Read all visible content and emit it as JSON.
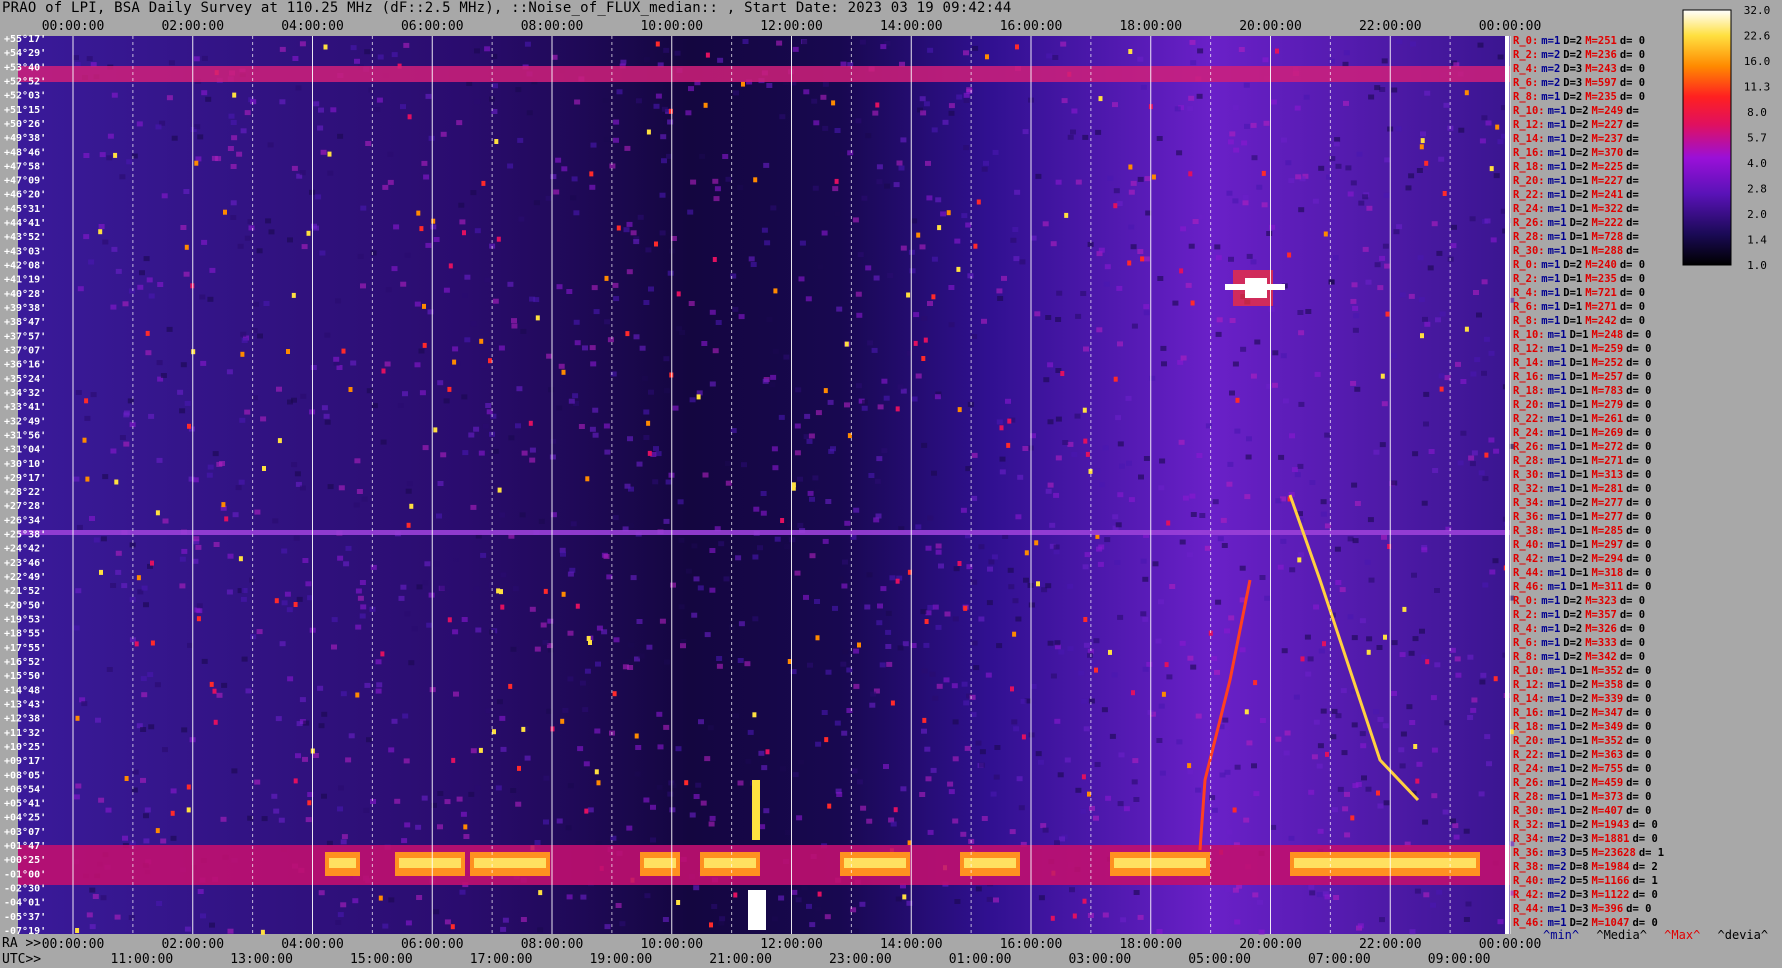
{
  "header": {
    "title": "PRAO of LPI, BSA Daily Survey at 110.25 MHz (dF::2.5 MHz), ::Noise_of_FLUX_median:: , Start Date: 2023 03 19 09:42:44"
  },
  "footer": {
    "ra_label": "RA >>",
    "utc_label": "UTC>>",
    "keys": [
      "^min^",
      "^Media^",
      "^Max^",
      "^devia^"
    ]
  },
  "chart_data": {
    "type": "heatmap",
    "title": "PRAO of LPI, BSA Daily Survey at 110.25 MHz (dF::2.5 MHz), ::Noise_of_FLUX_median:: , Start Date: 2023 03 19 09:42:44",
    "x_top_ticks": [
      "00:00:00",
      "02:00:00",
      "04:00:00",
      "06:00:00",
      "08:00:00",
      "10:00:00",
      "12:00:00",
      "14:00:00",
      "16:00:00",
      "18:00:00",
      "20:00:00",
      "22:00:00",
      "00:00:00"
    ],
    "x_bottom_ra_ticks": [
      "00:00:00",
      "02:00:00",
      "04:00:00",
      "06:00:00",
      "08:00:00",
      "10:00:00",
      "12:00:00",
      "14:00:00",
      "16:00:00",
      "18:00:00",
      "20:00:00",
      "22:00:00",
      "00:00:00"
    ],
    "x_bottom_utc_ticks": [
      "11:00:00",
      "13:00:00",
      "15:00:00",
      "17:00:00",
      "19:00:00",
      "21:00:00",
      "23:00:00",
      "01:00:00",
      "03:00:00",
      "05:00:00",
      "07:00:00",
      "09:00:00"
    ],
    "y_ticks": [
      "+55°17'",
      "+54°29'",
      "+53°40'",
      "+52°52'",
      "+52°03'",
      "+51°15'",
      "+50°26'",
      "+49°38'",
      "+48°46'",
      "+47°58'",
      "+47°09'",
      "+46°20'",
      "+45°31'",
      "+44°41'",
      "+43°52'",
      "+43°03'",
      "+42°08'",
      "+41°19'",
      "+40°28'",
      "+39°38'",
      "+38°47'",
      "+37°57'",
      "+37°07'",
      "+36°16'",
      "+35°24'",
      "+34°32'",
      "+33°41'",
      "+32°49'",
      "+31°56'",
      "+31°04'",
      "+30°10'",
      "+29°17'",
      "+28°22'",
      "+27°28'",
      "+26°34'",
      "+25°38'",
      "+24°42'",
      "+23°46'",
      "+22°49'",
      "+21°52'",
      "+20°50'",
      "+19°53'",
      "+18°55'",
      "+17°55'",
      "+16°52'",
      "+15°50'",
      "+14°48'",
      "+13°43'",
      "+12°38'",
      "+11°32'",
      "+10°25'",
      "+09°17'",
      "+08°05'",
      "+06°54'",
      "+05°41'",
      "+04°25'",
      "+03°07'",
      "+01°47'",
      "+00°25'",
      "-01°00'",
      "-02°30'",
      "-04°01'",
      "-05°37'",
      "-07°19'"
    ],
    "colorbar": {
      "ticks": [
        "32.0",
        "22.6",
        "16.0",
        "11.3",
        "8.0",
        "5.7",
        "4.0",
        "2.8",
        "2.0",
        "1.4",
        "1.0"
      ],
      "scale": "log"
    },
    "right_stats": [
      {
        "r": "R_0:",
        "m": "m=1",
        "D": "D=2",
        "M": "M=251",
        "d": "d= 0"
      },
      {
        "r": "R_2:",
        "m": "m=2",
        "D": "D=2",
        "M": "M=236",
        "d": "d= 0"
      },
      {
        "r": "R_4:",
        "m": "m=2",
        "D": "D=3",
        "M": "M=243",
        "d": "d= 0"
      },
      {
        "r": "R_6:",
        "m": "m=2",
        "D": "D=3",
        "M": "M=597",
        "d": "d= 0"
      },
      {
        "r": "R_8:",
        "m": "m=1",
        "D": "D=2",
        "M": "M=235",
        "d": "d= 0"
      },
      {
        "r": "R_10:",
        "m": "m=1",
        "D": "D=2",
        "M": "M=249",
        "d": "d="
      },
      {
        "r": "R_12:",
        "m": "m=1",
        "D": "D=2",
        "M": "M=227",
        "d": "d="
      },
      {
        "r": "R_14:",
        "m": "m=1",
        "D": "D=2",
        "M": "M=237",
        "d": "d="
      },
      {
        "r": "R_16:",
        "m": "m=1",
        "D": "D=2",
        "M": "M=370",
        "d": "d="
      },
      {
        "r": "R_18:",
        "m": "m=1",
        "D": "D=2",
        "M": "M=225",
        "d": "d="
      },
      {
        "r": "R_20:",
        "m": "m=1",
        "D": "D=1",
        "M": "M=227",
        "d": "d="
      },
      {
        "r": "R_22:",
        "m": "m=1",
        "D": "D=2",
        "M": "M=241",
        "d": "d="
      },
      {
        "r": "R_24:",
        "m": "m=1",
        "D": "D=1",
        "M": "M=322",
        "d": "d="
      },
      {
        "r": "R_26:",
        "m": "m=1",
        "D": "D=2",
        "M": "M=222",
        "d": "d="
      },
      {
        "r": "R_28:",
        "m": "m=1",
        "D": "D=1",
        "M": "M=728",
        "d": "d="
      },
      {
        "r": "R_30:",
        "m": "m=1",
        "D": "D=1",
        "M": "M=288",
        "d": "d="
      },
      {
        "r": "R_0:",
        "m": "m=1",
        "D": "D=2",
        "M": "M=240",
        "d": "d= 0"
      },
      {
        "r": "R_2:",
        "m": "m=1",
        "D": "D=1",
        "M": "M=235",
        "d": "d= 0"
      },
      {
        "r": "R_4:",
        "m": "m=1",
        "D": "D=1",
        "M": "M=721",
        "d": "d= 0"
      },
      {
        "r": "R_6:",
        "m": "m=1",
        "D": "D=1",
        "M": "M=271",
        "d": "d= 0"
      },
      {
        "r": "R_8:",
        "m": "m=1",
        "D": "D=1",
        "M": "M=242",
        "d": "d= 0"
      },
      {
        "r": "R_10:",
        "m": "m=1",
        "D": "D=1",
        "M": "M=248",
        "d": "d= 0"
      },
      {
        "r": "R_12:",
        "m": "m=1",
        "D": "D=1",
        "M": "M=259",
        "d": "d= 0"
      },
      {
        "r": "R_14:",
        "m": "m=1",
        "D": "D=1",
        "M": "M=252",
        "d": "d= 0"
      },
      {
        "r": "R_16:",
        "m": "m=1",
        "D": "D=1",
        "M": "M=257",
        "d": "d= 0"
      },
      {
        "r": "R_18:",
        "m": "m=1",
        "D": "D=1",
        "M": "M=783",
        "d": "d= 0"
      },
      {
        "r": "R_20:",
        "m": "m=1",
        "D": "D=1",
        "M": "M=279",
        "d": "d= 0"
      },
      {
        "r": "R_22:",
        "m": "m=1",
        "D": "D=1",
        "M": "M=261",
        "d": "d= 0"
      },
      {
        "r": "R_24:",
        "m": "m=1",
        "D": "D=1",
        "M": "M=269",
        "d": "d= 0"
      },
      {
        "r": "R_26:",
        "m": "m=1",
        "D": "D=1",
        "M": "M=272",
        "d": "d= 0"
      },
      {
        "r": "R_28:",
        "m": "m=1",
        "D": "D=1",
        "M": "M=271",
        "d": "d= 0"
      },
      {
        "r": "R_30:",
        "m": "m=1",
        "D": "D=1",
        "M": "M=313",
        "d": "d= 0"
      },
      {
        "r": "R_32:",
        "m": "m=1",
        "D": "D=1",
        "M": "M=281",
        "d": "d= 0"
      },
      {
        "r": "R_34:",
        "m": "m=1",
        "D": "D=2",
        "M": "M=277",
        "d": "d= 0"
      },
      {
        "r": "R_36:",
        "m": "m=1",
        "D": "D=1",
        "M": "M=277",
        "d": "d= 0"
      },
      {
        "r": "R_38:",
        "m": "m=1",
        "D": "D=1",
        "M": "M=285",
        "d": "d= 0"
      },
      {
        "r": "R_40:",
        "m": "m=1",
        "D": "D=1",
        "M": "M=297",
        "d": "d= 0"
      },
      {
        "r": "R_42:",
        "m": "m=1",
        "D": "D=2",
        "M": "M=294",
        "d": "d= 0"
      },
      {
        "r": "R_44:",
        "m": "m=1",
        "D": "D=1",
        "M": "M=318",
        "d": "d= 0"
      },
      {
        "r": "R_46:",
        "m": "m=1",
        "D": "D=1",
        "M": "M=311",
        "d": "d= 0"
      },
      {
        "r": "R_0:",
        "m": "m=1",
        "D": "D=2",
        "M": "M=323",
        "d": "d= 0"
      },
      {
        "r": "R_2:",
        "m": "m=1",
        "D": "D=2",
        "M": "M=357",
        "d": "d= 0"
      },
      {
        "r": "R_4:",
        "m": "m=1",
        "D": "D=2",
        "M": "M=326",
        "d": "d= 0"
      },
      {
        "r": "R_6:",
        "m": "m=1",
        "D": "D=2",
        "M": "M=333",
        "d": "d= 0"
      },
      {
        "r": "R_8:",
        "m": "m=1",
        "D": "D=2",
        "M": "M=342",
        "d": "d= 0"
      },
      {
        "r": "R_10:",
        "m": "m=1",
        "D": "D=1",
        "M": "M=352",
        "d": "d= 0"
      },
      {
        "r": "R_12:",
        "m": "m=1",
        "D": "D=2",
        "M": "M=358",
        "d": "d= 0"
      },
      {
        "r": "R_14:",
        "m": "m=1",
        "D": "D=2",
        "M": "M=339",
        "d": "d= 0"
      },
      {
        "r": "R_16:",
        "m": "m=1",
        "D": "D=2",
        "M": "M=347",
        "d": "d= 0"
      },
      {
        "r": "R_18:",
        "m": "m=1",
        "D": "D=2",
        "M": "M=349",
        "d": "d= 0"
      },
      {
        "r": "R_20:",
        "m": "m=1",
        "D": "D=1",
        "M": "M=352",
        "d": "d= 0"
      },
      {
        "r": "R_22:",
        "m": "m=1",
        "D": "D=2",
        "M": "M=363",
        "d": "d= 0"
      },
      {
        "r": "R_24:",
        "m": "m=1",
        "D": "D=2",
        "M": "M=755",
        "d": "d= 0"
      },
      {
        "r": "R_26:",
        "m": "m=1",
        "D": "D=2",
        "M": "M=459",
        "d": "d= 0"
      },
      {
        "r": "R_28:",
        "m": "m=1",
        "D": "D=1",
        "M": "M=373",
        "d": "d= 0"
      },
      {
        "r": "R_30:",
        "m": "m=1",
        "D": "D=2",
        "M": "M=407",
        "d": "d= 0"
      },
      {
        "r": "R_32:",
        "m": "m=1",
        "D": "D=2",
        "M": "M=1943",
        "d": "d= 0"
      },
      {
        "r": "R_34:",
        "m": "m=2",
        "D": "D=3",
        "M": "M=1881",
        "d": "d= 0"
      },
      {
        "r": "R_36:",
        "m": "m=3",
        "D": "D=5",
        "M": "M=23628",
        "d": "d= 1"
      },
      {
        "r": "R_38:",
        "m": "m=2",
        "D": "D=8",
        "M": "M=1984",
        "d": "d= 2"
      },
      {
        "r": "R_40:",
        "m": "m=2",
        "D": "D=5",
        "M": "M=1166",
        "d": "d= 1"
      },
      {
        "r": "R_42:",
        "m": "m=2",
        "D": "D=3",
        "M": "M=1122",
        "d": "d= 0"
      },
      {
        "r": "R_44:",
        "m": "m=1",
        "D": "D=3",
        "M": "M=396",
        "d": "d= 0"
      },
      {
        "r": "R_46:",
        "m": "m=1",
        "D": "D=2",
        "M": "M=1047",
        "d": "d= 0"
      }
    ]
  }
}
